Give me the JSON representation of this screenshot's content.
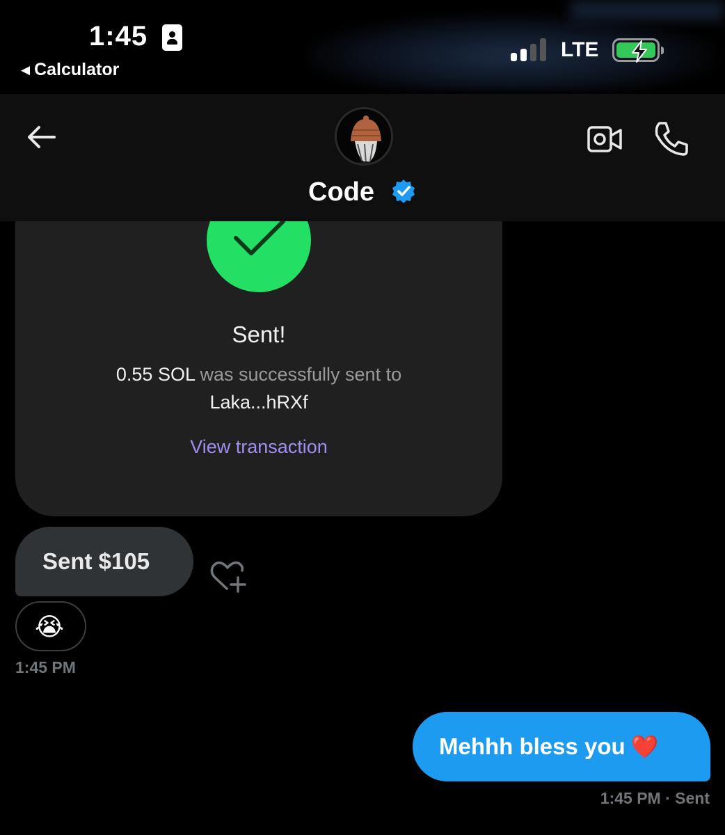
{
  "status_bar": {
    "time": "1:45",
    "back_app": "Calculator",
    "network": "LTE",
    "battery_charging": true,
    "signal_bars_active": 2,
    "signal_bars_total": 4
  },
  "header": {
    "contact_name": "Code",
    "verified": true,
    "icons": [
      "back-arrow-icon",
      "video-call-icon",
      "phone-call-icon",
      "verified-badge-icon"
    ]
  },
  "transaction_card": {
    "title": "Sent!",
    "amount": "0.55 SOL",
    "message": " was successfully sent to",
    "recipient": "Laka...hRXf",
    "link_label": "View transaction"
  },
  "messages": [
    {
      "direction": "incoming",
      "text": "Sent $105",
      "reaction": "😭",
      "timestamp": "1:45 PM"
    },
    {
      "direction": "outgoing",
      "text": "Mehhh bless you",
      "emoji": "❤️",
      "timestamp": "1:45 PM",
      "status": " · Sent"
    }
  ],
  "colors": {
    "background": "#000000",
    "header": "#0f0f0f",
    "card": "#202020",
    "success_green": "#23e065",
    "link_purple": "#a48df1",
    "outgoing_bubble": "#1d9bf0",
    "incoming_bubble": "#2f3336",
    "verified_blue": "#1d9bf0"
  }
}
